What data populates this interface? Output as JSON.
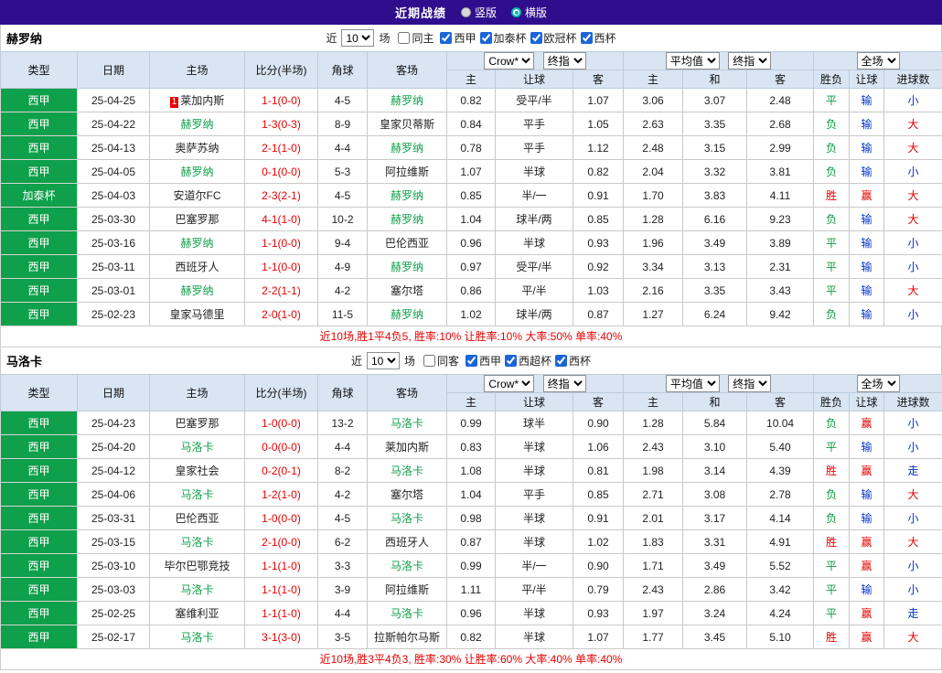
{
  "topbar": {
    "title": "近期战绩",
    "layout_options": [
      {
        "label": "竖版",
        "selected": false
      },
      {
        "label": "横版",
        "selected": true
      }
    ],
    "accent_color": "#00b4ad",
    "background_color": "#2e0e8c"
  },
  "filter_labels": {
    "near": "近",
    "matches": "场"
  },
  "table_header": {
    "type": "类型",
    "date": "日期",
    "home": "主场",
    "score": "比分(半场)",
    "corner": "角球",
    "away": "客场",
    "asia_select_1": "Crow*",
    "asia_select_2": "终指",
    "asia_sub": [
      "主",
      "让球",
      "客"
    ],
    "euro_select_1": "平均值",
    "euro_select_2": "终指",
    "euro_sub": [
      "主",
      "和",
      "客"
    ],
    "full_select": "全场",
    "result_sub": [
      "胜负",
      "让球",
      "进球数"
    ]
  },
  "result_colors": {
    "胜": "red",
    "赢": "red",
    "大": "red",
    "平": "green",
    "负": "green",
    "输": "blue",
    "小": "blue",
    "走": "blue"
  },
  "type_color": "#0ea04a",
  "score_color": "#e60000",
  "sections": [
    {
      "team": "赫罗纳",
      "filter": {
        "count": "10",
        "same_label": "同主",
        "leagues": [
          "西甲",
          "加泰杯",
          "欧冠杯",
          "西杯"
        ]
      },
      "rows": [
        {
          "type": "西甲",
          "date": "25-04-25",
          "home": "莱加内斯",
          "home_badge": "1",
          "score": "1-1(0-0)",
          "corner": "4-5",
          "away": "赫罗纳",
          "asia": [
            "0.82",
            "受平/半",
            "1.07"
          ],
          "euro": [
            "3.06",
            "3.07",
            "2.48"
          ],
          "res": [
            "平",
            "输",
            "小"
          ]
        },
        {
          "type": "西甲",
          "date": "25-04-22",
          "home": "赫罗纳",
          "score": "1-3(0-3)",
          "corner": "8-9",
          "away": "皇家贝蒂斯",
          "asia": [
            "0.84",
            "平手",
            "1.05"
          ],
          "euro": [
            "2.63",
            "3.35",
            "2.68"
          ],
          "res": [
            "负",
            "输",
            "大"
          ]
        },
        {
          "type": "西甲",
          "date": "25-04-13",
          "home": "奥萨苏纳",
          "score": "2-1(1-0)",
          "corner": "4-4",
          "away": "赫罗纳",
          "asia": [
            "0.78",
            "平手",
            "1.12"
          ],
          "euro": [
            "2.48",
            "3.15",
            "2.99"
          ],
          "res": [
            "负",
            "输",
            "大"
          ]
        },
        {
          "type": "西甲",
          "date": "25-04-05",
          "home": "赫罗纳",
          "score": "0-1(0-0)",
          "corner": "5-3",
          "away": "阿拉维斯",
          "asia": [
            "1.07",
            "半球",
            "0.82"
          ],
          "euro": [
            "2.04",
            "3.32",
            "3.81"
          ],
          "res": [
            "负",
            "输",
            "小"
          ]
        },
        {
          "type": "加泰杯",
          "date": "25-04-03",
          "home": "安道尔FC",
          "score": "2-3(2-1)",
          "corner": "4-5",
          "away": "赫罗纳",
          "asia": [
            "0.85",
            "半/一",
            "0.91"
          ],
          "euro": [
            "1.70",
            "3.83",
            "4.11"
          ],
          "res": [
            "胜",
            "赢",
            "大"
          ]
        },
        {
          "type": "西甲",
          "date": "25-03-30",
          "home": "巴塞罗那",
          "score": "4-1(1-0)",
          "corner": "10-2",
          "away": "赫罗纳",
          "asia": [
            "1.04",
            "球半/两",
            "0.85"
          ],
          "euro": [
            "1.28",
            "6.16",
            "9.23"
          ],
          "res": [
            "负",
            "输",
            "大"
          ]
        },
        {
          "type": "西甲",
          "date": "25-03-16",
          "home": "赫罗纳",
          "score": "1-1(0-0)",
          "corner": "9-4",
          "away": "巴伦西亚",
          "asia": [
            "0.96",
            "半球",
            "0.93"
          ],
          "euro": [
            "1.96",
            "3.49",
            "3.89"
          ],
          "res": [
            "平",
            "输",
            "小"
          ]
        },
        {
          "type": "西甲",
          "date": "25-03-11",
          "home": "西班牙人",
          "score": "1-1(0-0)",
          "corner": "4-9",
          "away": "赫罗纳",
          "asia": [
            "0.97",
            "受平/半",
            "0.92"
          ],
          "euro": [
            "3.34",
            "3.13",
            "2.31"
          ],
          "res": [
            "平",
            "输",
            "小"
          ]
        },
        {
          "type": "西甲",
          "date": "25-03-01",
          "home": "赫罗纳",
          "score": "2-2(1-1)",
          "corner": "4-2",
          "away": "塞尔塔",
          "asia": [
            "0.86",
            "平/半",
            "1.03"
          ],
          "euro": [
            "2.16",
            "3.35",
            "3.43"
          ],
          "res": [
            "平",
            "输",
            "大"
          ]
        },
        {
          "type": "西甲",
          "date": "25-02-23",
          "home": "皇家马德里",
          "score": "2-0(1-0)",
          "corner": "11-5",
          "away": "赫罗纳",
          "asia": [
            "1.02",
            "球半/两",
            "0.87"
          ],
          "euro": [
            "1.27",
            "6.24",
            "9.42"
          ],
          "res": [
            "负",
            "输",
            "小"
          ]
        }
      ],
      "summary": "近10场,胜1平4负5, 胜率:10% 让胜率:10% 大率:50% 单率:40%"
    },
    {
      "team": "马洛卡",
      "filter": {
        "count": "10",
        "same_label": "同客",
        "leagues": [
          "西甲",
          "西超杯",
          "西杯"
        ]
      },
      "rows": [
        {
          "type": "西甲",
          "date": "25-04-23",
          "home": "巴塞罗那",
          "score": "1-0(0-0)",
          "corner": "13-2",
          "away": "马洛卡",
          "asia": [
            "0.99",
            "球半",
            "0.90"
          ],
          "euro": [
            "1.28",
            "5.84",
            "10.04"
          ],
          "res": [
            "负",
            "赢",
            "小"
          ]
        },
        {
          "type": "西甲",
          "date": "25-04-20",
          "home": "马洛卡",
          "score": "0-0(0-0)",
          "corner": "4-4",
          "away": "莱加内斯",
          "asia": [
            "0.83",
            "半球",
            "1.06"
          ],
          "euro": [
            "2.43",
            "3.10",
            "5.40"
          ],
          "res": [
            "平",
            "输",
            "小"
          ]
        },
        {
          "type": "西甲",
          "date": "25-04-12",
          "home": "皇家社会",
          "score": "0-2(0-1)",
          "corner": "8-2",
          "away": "马洛卡",
          "asia": [
            "1.08",
            "半球",
            "0.81"
          ],
          "euro": [
            "1.98",
            "3.14",
            "4.39"
          ],
          "res": [
            "胜",
            "赢",
            "走"
          ]
        },
        {
          "type": "西甲",
          "date": "25-04-06",
          "home": "马洛卡",
          "score": "1-2(1-0)",
          "corner": "4-2",
          "away": "塞尔塔",
          "asia": [
            "1.04",
            "平手",
            "0.85"
          ],
          "euro": [
            "2.71",
            "3.08",
            "2.78"
          ],
          "res": [
            "负",
            "输",
            "大"
          ]
        },
        {
          "type": "西甲",
          "date": "25-03-31",
          "home": "巴伦西亚",
          "score": "1-0(0-0)",
          "corner": "4-5",
          "away": "马洛卡",
          "asia": [
            "0.98",
            "半球",
            "0.91"
          ],
          "euro": [
            "2.01",
            "3.17",
            "4.14"
          ],
          "res": [
            "负",
            "输",
            "小"
          ]
        },
        {
          "type": "西甲",
          "date": "25-03-15",
          "home": "马洛卡",
          "score": "2-1(0-0)",
          "corner": "6-2",
          "away": "西班牙人",
          "asia": [
            "0.87",
            "半球",
            "1.02"
          ],
          "euro": [
            "1.83",
            "3.31",
            "4.91"
          ],
          "res": [
            "胜",
            "赢",
            "大"
          ]
        },
        {
          "type": "西甲",
          "date": "25-03-10",
          "home": "毕尔巴鄂竞技",
          "score": "1-1(1-0)",
          "corner": "3-3",
          "away": "马洛卡",
          "asia": [
            "0.99",
            "半/一",
            "0.90"
          ],
          "euro": [
            "1.71",
            "3.49",
            "5.52"
          ],
          "res": [
            "平",
            "赢",
            "小"
          ]
        },
        {
          "type": "西甲",
          "date": "25-03-03",
          "home": "马洛卡",
          "score": "1-1(1-0)",
          "corner": "3-9",
          "away": "阿拉维斯",
          "asia": [
            "1.11",
            "平/半",
            "0.79"
          ],
          "euro": [
            "2.43",
            "2.86",
            "3.42"
          ],
          "res": [
            "平",
            "输",
            "小"
          ]
        },
        {
          "type": "西甲",
          "date": "25-02-25",
          "home": "塞维利亚",
          "score": "1-1(1-0)",
          "corner": "4-4",
          "away": "马洛卡",
          "asia": [
            "0.96",
            "半球",
            "0.93"
          ],
          "euro": [
            "1.97",
            "3.24",
            "4.24"
          ],
          "res": [
            "平",
            "赢",
            "走"
          ]
        },
        {
          "type": "西甲",
          "date": "25-02-17",
          "home": "马洛卡",
          "score": "3-1(3-0)",
          "corner": "3-5",
          "away": "拉斯帕尔马斯",
          "asia": [
            "0.82",
            "半球",
            "1.07"
          ],
          "euro": [
            "1.77",
            "3.45",
            "5.10"
          ],
          "res": [
            "胜",
            "赢",
            "大"
          ]
        }
      ],
      "summary": "近10场,胜3平4负3, 胜率:30% 让胜率:60% 大率:40% 单率:40%"
    }
  ]
}
